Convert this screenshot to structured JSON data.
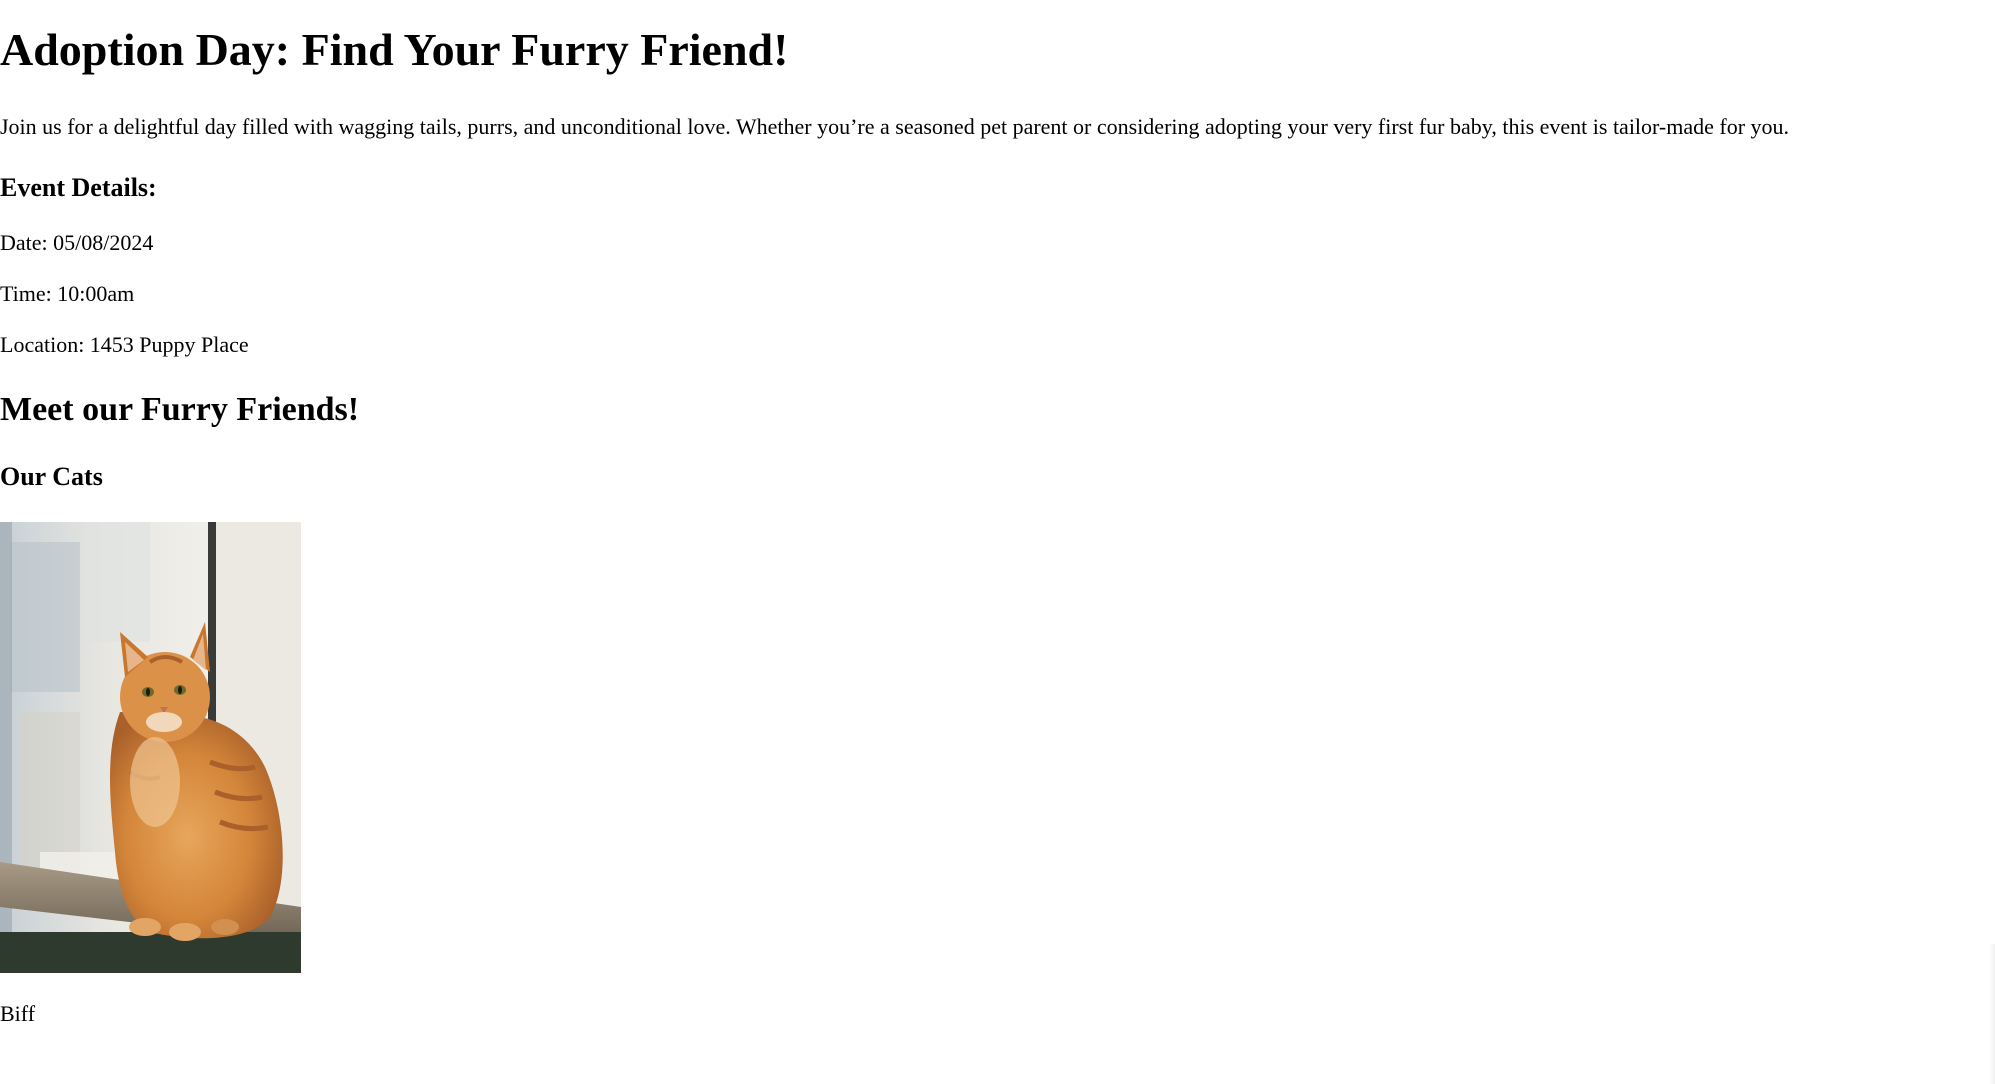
{
  "page": {
    "title": "Adoption Day: Find Your Furry Friend!",
    "intro": "Join us for a delightful day filled with wagging tails, purrs, and unconditional love. Whether you’re a seasoned pet parent or considering adopting your very first fur baby, this event is tailor-made for you."
  },
  "event_details": {
    "heading": "Event Details:",
    "date": "Date: 05/08/2024",
    "time": "Time: 10:00am",
    "location": "Location: 1453 Puppy Place"
  },
  "friends": {
    "heading": "Meet our Furry Friends!",
    "cats_heading": "Our Cats",
    "cats": [
      {
        "name": "Biff",
        "photo": "orange-tabby-cat-photo"
      }
    ]
  }
}
